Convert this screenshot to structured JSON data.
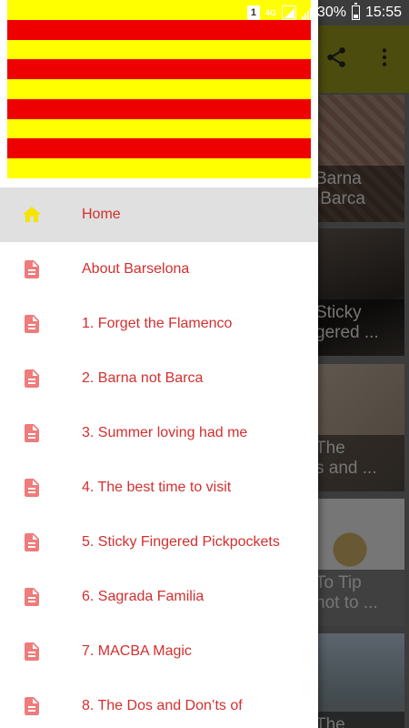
{
  "status_bar": {
    "sim": "1",
    "network": "4G",
    "battery": "30%",
    "time": "15:55"
  },
  "colors": {
    "flag_yellow": "#ffff00",
    "flag_red": "#ee0000",
    "menu_text": "#d32f2f",
    "home_icon": "#f4e400",
    "doc_icon": "#ef7b7b"
  },
  "toolbar": {
    "share_icon": "share-icon",
    "more_icon": "more-vert-icon"
  },
  "background_cards": [
    {
      "caption": "Barna\n Barca"
    },
    {
      "caption": "Sticky\ngered ..."
    },
    {
      "caption": "The\ns and ..."
    },
    {
      "caption": "To Tip\nnot to ..."
    },
    {
      "caption": "The"
    }
  ],
  "drawer": {
    "header_image": "catalan-flag",
    "items": [
      {
        "label": "Home",
        "icon": "home-icon",
        "active": true
      },
      {
        "label": "About Barselona",
        "icon": "document-icon"
      },
      {
        "label": "1. Forget the Flamenco",
        "icon": "document-icon"
      },
      {
        "label": "2. Barna not Barca",
        "icon": "document-icon"
      },
      {
        "label": "3. Summer loving had me",
        "icon": "document-icon"
      },
      {
        "label": "4. The best time to visit",
        "icon": "document-icon"
      },
      {
        "label": "5. Sticky Fingered Pickpockets",
        "icon": "document-icon"
      },
      {
        "label": "6. Sagrada Familia",
        "icon": "document-icon"
      },
      {
        "label": "7. MACBA Magic",
        "icon": "document-icon"
      },
      {
        "label": "8. The Dos and Don’ts of",
        "icon": "document-icon"
      }
    ]
  }
}
